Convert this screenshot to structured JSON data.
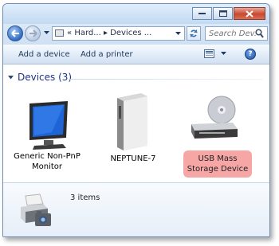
{
  "window": {
    "caption_buttons": {
      "minimize": "minimize-icon",
      "maximize": "maximize-icon",
      "close": "close-icon"
    }
  },
  "address_bar": {
    "breadcrumb_prefix": "«",
    "path": "Hard... ▸ Devices ...",
    "search_placeholder": "Search Dev..."
  },
  "command_bar": {
    "add_device_label": "Add a device",
    "add_printer_label": "Add a printer"
  },
  "devices_group": {
    "header": "Devices (3)",
    "items": [
      {
        "label_line1": "Generic Non-PnP",
        "label_line2": "Monitor",
        "icon": "monitor-icon"
      },
      {
        "label_line1": "NEPTUNE-7",
        "icon": "computer-tower-icon"
      },
      {
        "label_line1": "USB Mass",
        "label_line2": "Storage Device",
        "icon": "usb-storage-icon",
        "selected": true
      }
    ]
  },
  "details_pane": {
    "count": "3 items",
    "icon": "devices-and-printers-icon"
  },
  "colors": {
    "selection": "#f7a6a6",
    "group_header": "#1e3287",
    "close_button": "#c8492f"
  }
}
